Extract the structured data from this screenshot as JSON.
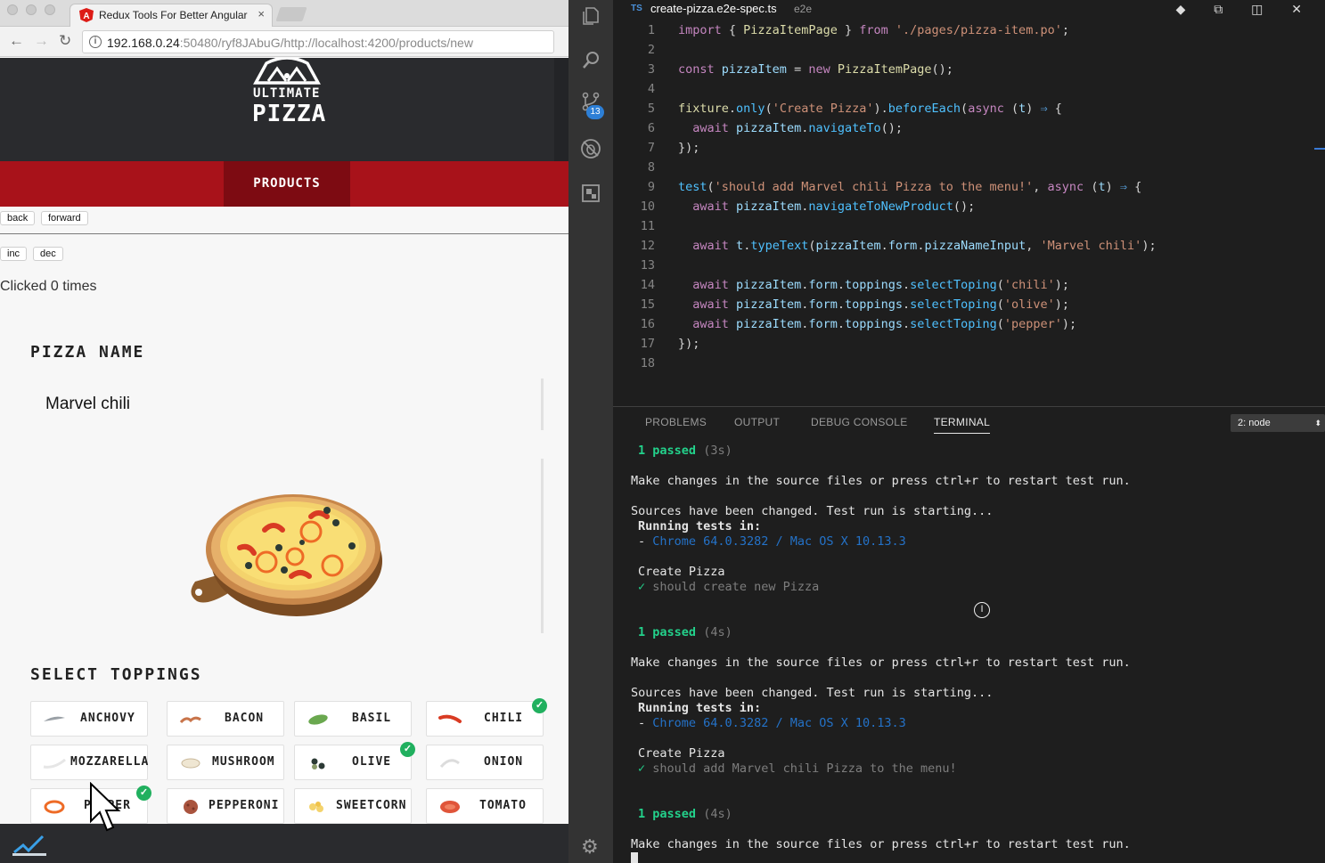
{
  "browser": {
    "tab_title": "Redux Tools For Better Angular",
    "tab_close": "×",
    "url_host": "192.168.0.24",
    "url_rest": ":50480/ryf8JAbuG/http://localhost:4200/products/new",
    "nav_back": "←",
    "nav_forward": "→",
    "nav_reload": "↻"
  },
  "site": {
    "logo_line1": "ULTIMATE",
    "logo_line2": "PIZZA",
    "nav_products": "PRODUCTS",
    "btn_back": "back",
    "btn_forward": "forward",
    "btn_inc": "inc",
    "btn_dec": "dec",
    "clicked_text": "Clicked 0 times",
    "pizza_name_heading": "PIZZA NAME",
    "pizza_name_value": "Marvel chili",
    "toppings_heading": "SELECT TOPPINGS",
    "toppings": [
      {
        "label": "ANCHOVY",
        "selected": false,
        "icon": "anchovy-icon"
      },
      {
        "label": "BACON",
        "selected": false,
        "icon": "bacon-icon"
      },
      {
        "label": "BASIL",
        "selected": false,
        "icon": "basil-icon"
      },
      {
        "label": "CHILI",
        "selected": true,
        "icon": "chili-icon"
      },
      {
        "label": "MOZZARELLA",
        "selected": false,
        "icon": "mozzarella-icon"
      },
      {
        "label": "MUSHROOM",
        "selected": false,
        "icon": "mushroom-icon"
      },
      {
        "label": "OLIVE",
        "selected": true,
        "icon": "olive-icon"
      },
      {
        "label": "ONION",
        "selected": false,
        "icon": "onion-icon"
      },
      {
        "label": "PEPPER",
        "selected": true,
        "icon": "pepper-icon"
      },
      {
        "label": "PEPPERONI",
        "selected": false,
        "icon": "pepperoni-icon"
      },
      {
        "label": "SWEETCORN",
        "selected": false,
        "icon": "sweetcorn-icon"
      },
      {
        "label": "TOMATO",
        "selected": false,
        "icon": "tomato-icon"
      }
    ],
    "colors": {
      "header": "#2a2b2e",
      "nav": "#a8121a",
      "nav_active": "#7d0b12",
      "check": "#21b05f"
    }
  },
  "vscode": {
    "scm_badge": "13",
    "file_lang": "TS",
    "file_name": "create-pizza.e2e-spec.ts",
    "file_dir": "e2e",
    "title_actions": "◆ ⧉ ◫ ✕",
    "line_numbers": [
      "1",
      "2",
      "3",
      "4",
      "5",
      "6",
      "7",
      "8",
      "9",
      "10",
      "11",
      "12",
      "13",
      "14",
      "15",
      "16",
      "17",
      "18"
    ],
    "panel_tabs": [
      "PROBLEMS",
      "OUTPUT",
      "DEBUG CONSOLE",
      "TERMINAL"
    ],
    "terminal_select": "2: node",
    "terminal_select_arrow": "⬍",
    "term": {
      "passed_count": "1",
      "passed_word": "passed",
      "time1": "(3s)",
      "time2": "(4s)",
      "time3": "(4s)",
      "make_changes": "Make changes in the source files or press ctrl+r to restart test run.",
      "sources_changed": "Sources have been changed. Test run is starting...",
      "running_tests": "Running tests in:",
      "dash": "-",
      "browser": "Chrome 64.0.3282 / Mac OS X 10.13.3",
      "fixture": "Create Pizza",
      "check": "✓",
      "test1": "should create new Pizza",
      "test2": "should add Marvel chili Pizza to the menu!"
    }
  }
}
